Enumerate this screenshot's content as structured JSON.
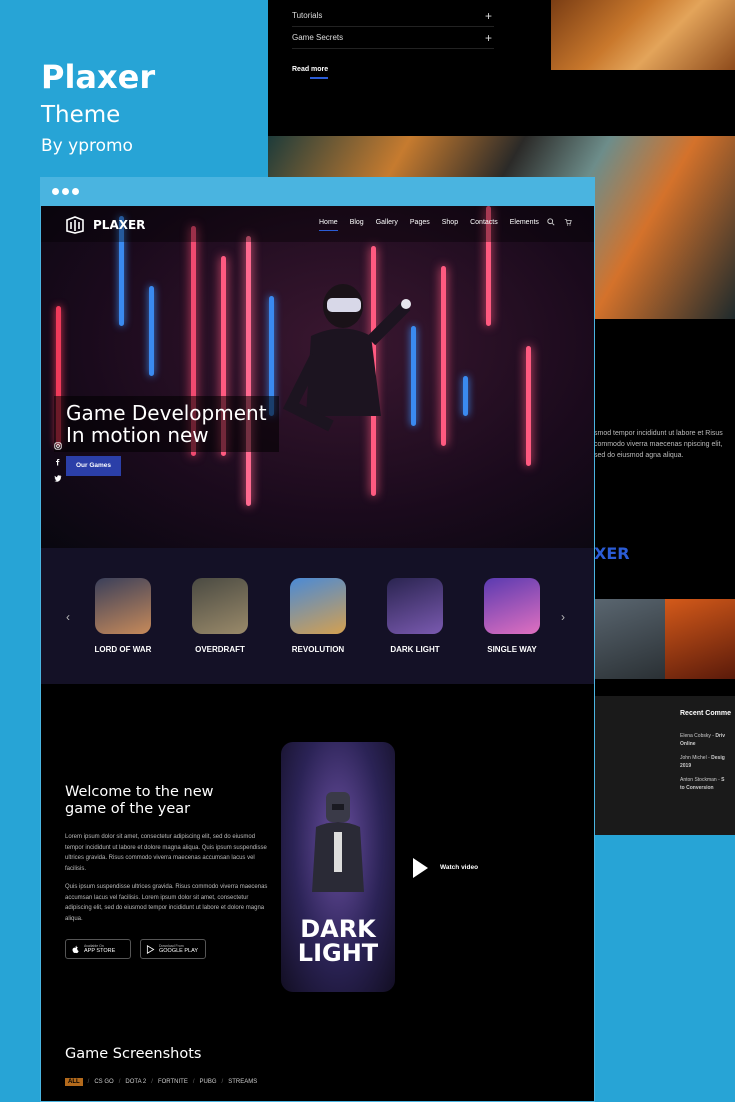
{
  "brand": {
    "name": "Plaxer",
    "theme": "Theme",
    "by": "By ypromo"
  },
  "back": {
    "accordion": [
      "Tutorials",
      "Game Secrets"
    ],
    "read_more": "Read more",
    "text": "smod tempor incididunt ut labore et Risus commodo viverra maecenas npiscing elit, sed do eiusmod agna aliqua.",
    "logo_fragment": "XER",
    "footer_heading": "Recent Comme",
    "comments": [
      {
        "who": "Elena Cobsky",
        "sep": " - ",
        "what": "Driv",
        "line2": "Online"
      },
      {
        "who": "John Michel",
        "sep": " - ",
        "what": "Desig",
        "line2": "2019"
      },
      {
        "who": "Anton Stockman",
        "sep": " - ",
        "what": "S",
        "line2": "to Conversion"
      }
    ]
  },
  "nav": {
    "logo": "PLAXER",
    "items": [
      "Home",
      "Blog",
      "Gallery",
      "Pages",
      "Shop",
      "Contacts",
      "Elements"
    ]
  },
  "hero": {
    "title": "Game Development\nIn motion new",
    "cta": "Our Games"
  },
  "games": [
    {
      "label": "LORD OF WAR",
      "c1": "#3a3f5a",
      "c2": "#c78a5a"
    },
    {
      "label": "OVERDRAFT",
      "c1": "#4a4a42",
      "c2": "#9a8a6a"
    },
    {
      "label": "REVOLUTION",
      "c1": "#4a8ad6",
      "c2": "#d4a050"
    },
    {
      "label": "DARK LIGHT",
      "c1": "#2a2450",
      "c2": "#7a5ab0"
    },
    {
      "label": "SINGLE WAY",
      "c1": "#5a3ab0",
      "c2": "#e070c0"
    }
  ],
  "welcome": {
    "title": "Welcome to the new\ngame of the year",
    "p1": "Lorem ipsum dolor sit amet, consectetur adipiscing elit, sed do eiusmod tempor incididunt ut labore et dolore magna aliqua. Quis ipsum suspendisse ultrices gravida. Risus commodo viverra maecenas accumsan lacus vel facilisis.",
    "p2": "Quis ipsum suspendisse ultrices gravida. Risus commodo viverra maecenas accumsan lacus vel facilisis. Lorem ipsum dolor sit amet, consectetur adipiscing elit, sed do eiusmod tempor incididunt ut labore et dolore magna aliqua.",
    "appstore": {
      "small": "Available On",
      "big": "APP STORE"
    },
    "googleplay": {
      "small": "Download From",
      "big": "GOOGLE PLAY"
    },
    "phone_title": "DARK\nLIGHT",
    "watch": "Watch video"
  },
  "shots": {
    "title": "Game Screenshots",
    "filters": [
      "ALL",
      "CS GO",
      "DOTA 2",
      "FORTNITE",
      "PUBG",
      "STREAMS"
    ]
  },
  "colors": {
    "bg": "#27a4d6",
    "accent": "#2b5cd6",
    "window_bar": "#4ab4e0"
  }
}
